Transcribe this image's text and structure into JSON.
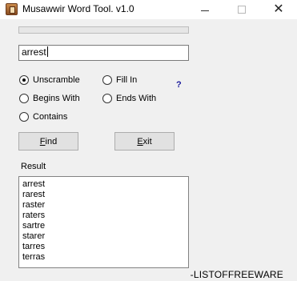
{
  "window": {
    "title": "Musawwir Word Tool. v1.0",
    "icon": "book-icon"
  },
  "progress": {
    "percent": 0
  },
  "input": {
    "value": "arrest"
  },
  "options": {
    "unscramble": "Unscramble",
    "begins_with": "Begins With",
    "contains": "Contains",
    "fill_in": "Fill In",
    "ends_with": "Ends With",
    "selected": "unscramble"
  },
  "help": "?",
  "buttons": {
    "find": {
      "first": "F",
      "rest": "ind"
    },
    "exit": {
      "first": "E",
      "rest": "xit"
    }
  },
  "result": {
    "label": "Result",
    "words": [
      "arrest",
      "rarest",
      "raster",
      "raters",
      "sartre",
      "starer",
      "tarres",
      "terras"
    ]
  },
  "brand": "-LISTOFFREEWARE"
}
